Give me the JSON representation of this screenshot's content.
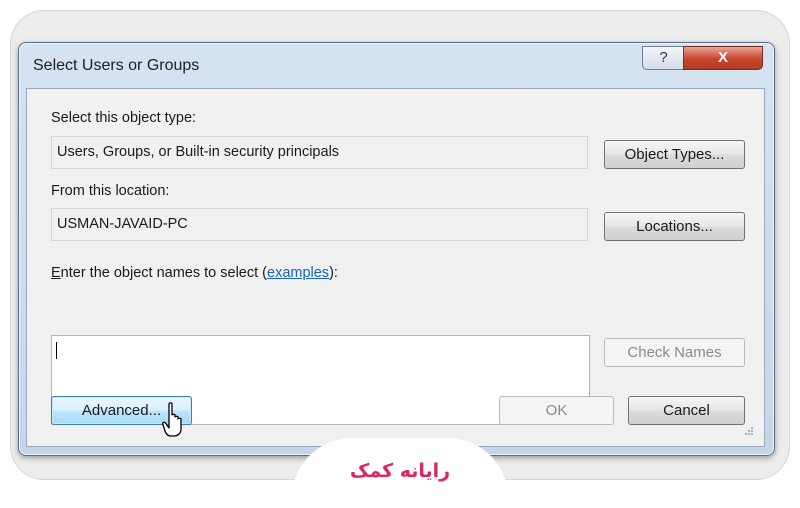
{
  "dialog": {
    "title": "Select Users or Groups",
    "help_glyph": "?",
    "close_glyph": "X"
  },
  "object_type": {
    "label": "Select this object type:",
    "value": "Users, Groups, or Built-in security principals",
    "button": "Object Types..."
  },
  "location": {
    "label": "From this location:",
    "value": "USMAN-JAVAID-PC",
    "button": "Locations..."
  },
  "names": {
    "label_prefix_accel": "E",
    "label_prefix_rest": "nter the object names to select (",
    "link": "examples",
    "label_suffix": "):",
    "value": "",
    "check_button": "Check Names"
  },
  "buttons": {
    "advanced": "Advanced...",
    "ok": "OK",
    "cancel": "Cancel"
  },
  "watermark": {
    "text": "رایانه کمک",
    "color": "#e0245e"
  }
}
